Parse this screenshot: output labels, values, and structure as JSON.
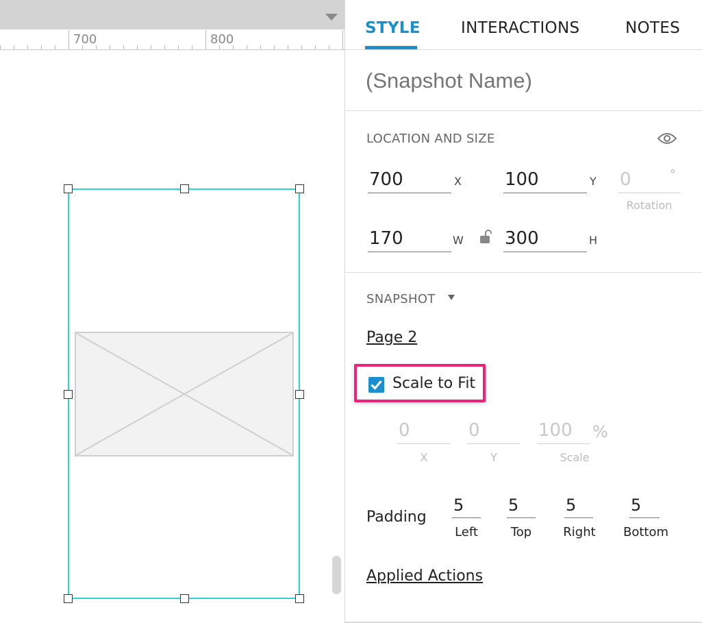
{
  "canvas": {
    "ruler": {
      "labels": [
        "700",
        "800"
      ]
    }
  },
  "panel": {
    "tabs": [
      {
        "label": "STYLE",
        "active": true
      },
      {
        "label": "INTERACTIONS",
        "active": false
      },
      {
        "label": "NOTES",
        "active": false
      }
    ],
    "snapshot_name_placeholder": "(Snapshot Name)",
    "location_size": {
      "title": "LOCATION AND SIZE",
      "x": "700",
      "x_label": "X",
      "y": "100",
      "y_label": "Y",
      "rotation": "0",
      "rotation_unit": "°",
      "rotation_label": "Rotation",
      "w": "170",
      "w_label": "W",
      "h": "300",
      "h_label": "H"
    },
    "snapshot": {
      "title": "SNAPSHOT",
      "page_link": "Page 2",
      "scale_to_fit": {
        "label": "Scale to Fit",
        "checked": true
      },
      "offset_x": "0",
      "offset_x_label": "X",
      "offset_y": "0",
      "offset_y_label": "Y",
      "scale": "100",
      "scale_unit": "%",
      "scale_label": "Scale",
      "padding": {
        "label": "Padding",
        "left": "5",
        "left_label": "Left",
        "top": "5",
        "top_label": "Top",
        "right": "5",
        "right_label": "Right",
        "bottom": "5",
        "bottom_label": "Bottom"
      },
      "applied_actions_link": "Applied Actions"
    }
  },
  "colors": {
    "accent": "#1a8fcc",
    "selection": "#2fd0dc",
    "highlight": "#f0217a"
  },
  "icons": {
    "dropdown": "triangle-down-icon",
    "visibility": "eye-icon",
    "lock": "unlocked-padlock-icon",
    "check": "checkmark-icon",
    "placeholder": "image-placeholder-icon"
  }
}
